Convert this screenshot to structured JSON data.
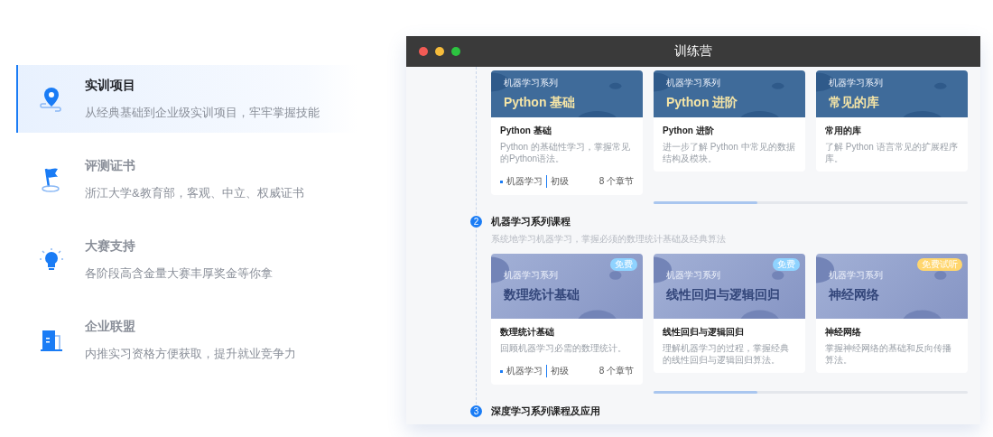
{
  "features": [
    {
      "kind": "pin",
      "title": "实训项目",
      "description": "从经典基础到企业级实训项目，牢牢掌握技能",
      "selected": true
    },
    {
      "kind": "flag",
      "title": "评测证书",
      "description": "浙江大学&教育部，客观、中立、权威证书",
      "selected": false
    },
    {
      "kind": "bulb",
      "title": "大赛支持",
      "description": "各阶段高含金量大赛丰厚奖金等你拿",
      "selected": false
    },
    {
      "kind": "building",
      "title": "企业联盟",
      "description": "内推实习资格方便获取，提升就业竞争力",
      "selected": false
    }
  ],
  "window": {
    "title": "训练营"
  },
  "sections": [
    {
      "kind": "dark-banner",
      "courses": [
        {
          "series": "机器学习系列",
          "banner_title": "Python 基础",
          "name": "Python 基础",
          "description": "Python 的基础性学习，掌握常见的Python语法。",
          "footer": {
            "category": "机器学习",
            "level": "初级",
            "chapters": "8 个章节"
          }
        },
        {
          "series": "机器学习系列",
          "banner_title": "Python 进阶",
          "name": "Python 进阶",
          "description": "进一步了解 Python 中常见的数据结构及模块。"
        },
        {
          "series": "机器学习系列",
          "banner_title": "常见的库",
          "name": "常用的库",
          "description": "了解 Python 语言常见的扩展程序库。"
        }
      ]
    },
    {
      "kind": "light-banner",
      "step": "2",
      "title": "机器学习系列课程",
      "description": "系统地学习机器学习，掌握必须的数理统计基础及经典算法",
      "courses": [
        {
          "series": "机器学习系列",
          "banner_title": "数理统计基础",
          "badge": {
            "label": "免费",
            "color": "#8fd3ff"
          },
          "name": "数理统计基础",
          "description": "回顾机器学习必需的数理统计。",
          "footer": {
            "category": "机器学习",
            "level": "初级",
            "chapters": "8 个章节"
          }
        },
        {
          "series": "机器学习系列",
          "banner_title": "线性回归与逻辑回归",
          "badge": {
            "label": "免费",
            "color": "#8fd3ff"
          },
          "name": "线性回归与逻辑回归",
          "description": "理解机器学习的过程，掌握经典的线性回归与逻辑回归算法。"
        },
        {
          "series": "机器学习系列",
          "banner_title": "神经网络",
          "badge": {
            "label": "免费试听",
            "color": "#ffd66e"
          },
          "name": "神经网络",
          "description": "掌握神经网络的基础和反向传播算法。"
        }
      ]
    },
    {
      "step": "3",
      "title": "深度学习系列课程及应用"
    }
  ]
}
